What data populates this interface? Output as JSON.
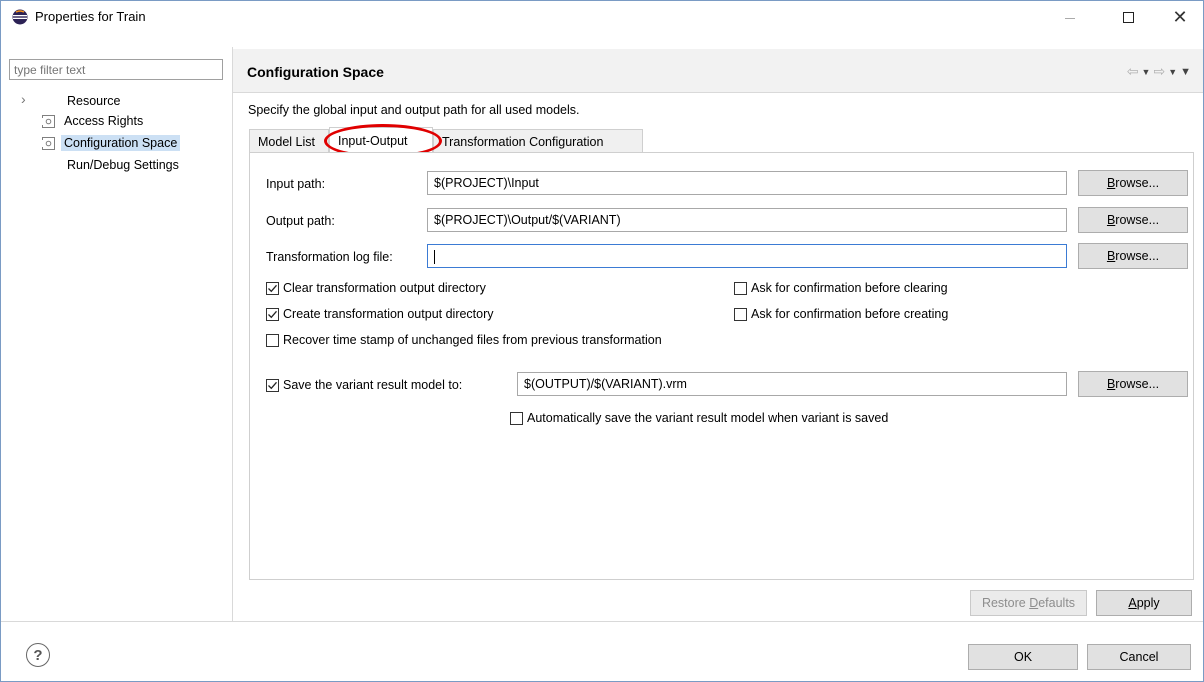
{
  "window": {
    "title": "Properties for Train",
    "minimize": "—",
    "close": "✕"
  },
  "sidebar": {
    "filter_placeholder": "type filter text",
    "items": [
      {
        "label": "Resource",
        "expandable": true
      },
      {
        "label": "Access Rights"
      },
      {
        "label": "Configuration Space",
        "selected": true
      },
      {
        "label": "Run/Debug Settings"
      }
    ]
  },
  "page": {
    "title": "Configuration Space",
    "description": "Specify the global input and output path for all used models."
  },
  "tabs": [
    {
      "label": "Model List"
    },
    {
      "label": "Input-Output",
      "active": true
    },
    {
      "label": "Transformation Configuration"
    }
  ],
  "form": {
    "input_path_label": "Input path:",
    "input_path_value": "$(PROJECT)\\Input",
    "output_path_label": "Output path:",
    "output_path_value": "$(PROJECT)\\Output/$(VARIANT)",
    "log_file_label": "Transformation log file:",
    "log_file_value": "",
    "browse": "Browse...",
    "browse_mnemonic": "B",
    "browse_rest": "rowse...",
    "clear_dir_label": "Clear transformation output directory",
    "clear_dir_checked": true,
    "confirm_clear_label": "Ask for confirmation before clearing",
    "confirm_clear_checked": false,
    "create_dir_label": "Create transformation output directory",
    "create_dir_checked": true,
    "confirm_create_label": "Ask for confirmation before creating",
    "confirm_create_checked": false,
    "recover_label": "Recover time stamp of unchanged files from previous transformation",
    "recover_checked": false,
    "save_variant_label": "Save the variant result model to:",
    "save_variant_checked": true,
    "save_variant_value": "$(OUTPUT)/$(VARIANT).vrm",
    "auto_save_label": "Automatically save the variant result model when variant is saved",
    "auto_save_checked": false
  },
  "buttons": {
    "restore_defaults_pre": "Restore ",
    "restore_defaults_mnemonic": "D",
    "restore_defaults_post": "efaults",
    "apply_mnemonic": "A",
    "apply_post": "pply",
    "ok": "OK",
    "cancel": "Cancel",
    "help": "?"
  },
  "colors": {
    "accent_focus": "#3b7bd4",
    "highlight_circle": "#e00000",
    "selection": "#cce0f4"
  }
}
